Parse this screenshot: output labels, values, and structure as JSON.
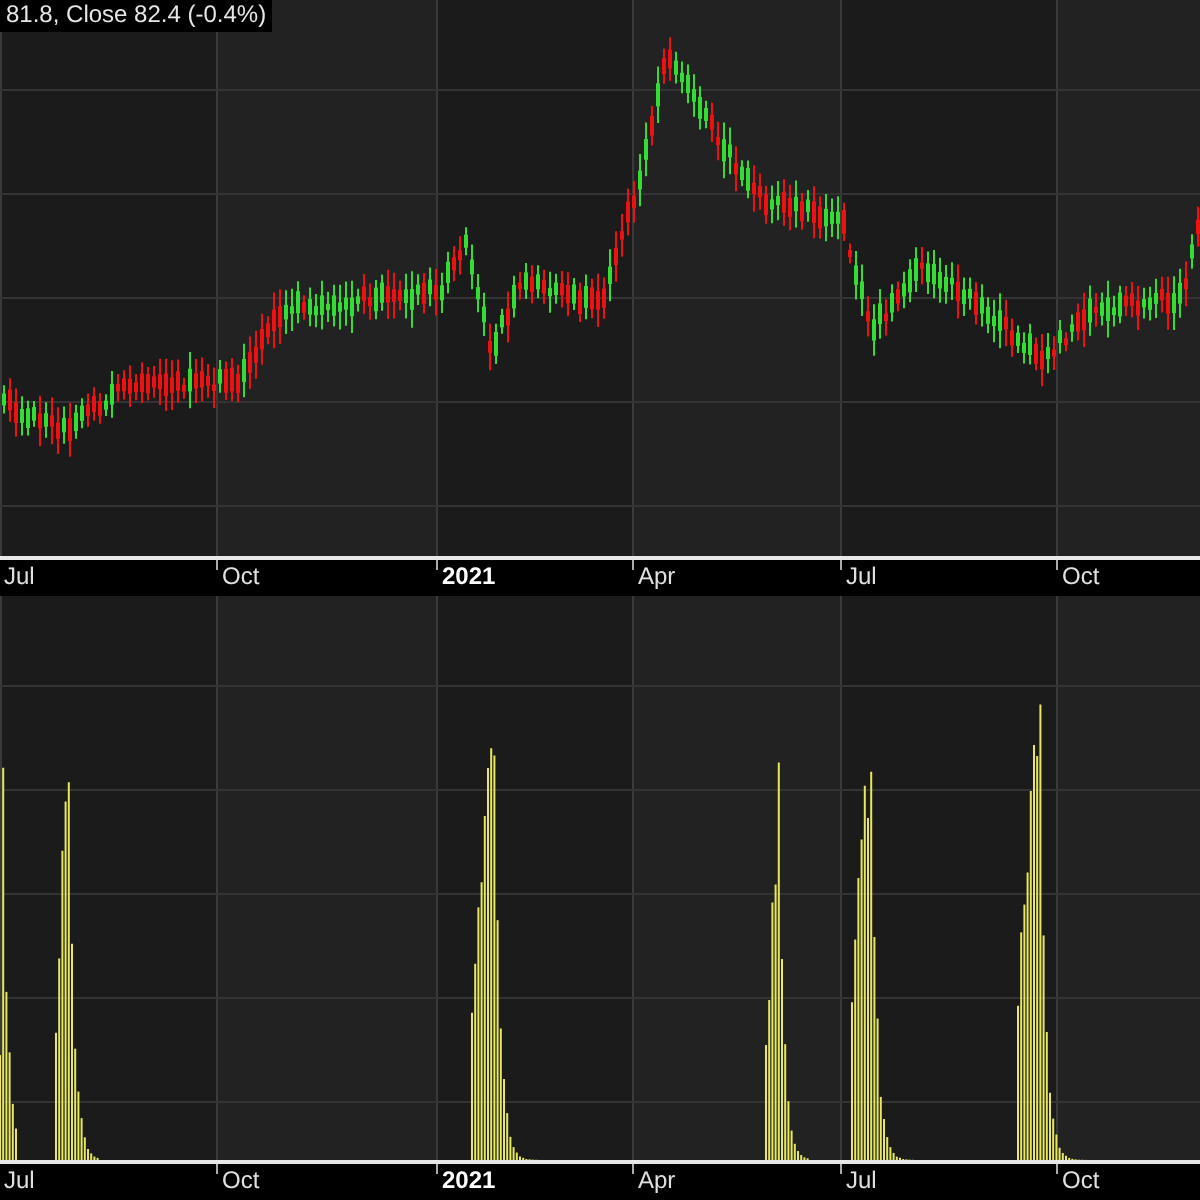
{
  "legend": "81.8, Close 82.4 (-0.4%)",
  "price_panel": {
    "axis_labels": [
      {
        "text": "Jul",
        "kind": "month"
      },
      {
        "text": "Oct",
        "kind": "month"
      },
      {
        "text": "2021",
        "kind": "year"
      },
      {
        "text": "Apr",
        "kind": "month"
      },
      {
        "text": "Jul",
        "kind": "month"
      },
      {
        "text": "Oct",
        "kind": "month"
      }
    ]
  },
  "indicator_panel": {
    "axis_labels": [
      {
        "text": "Jul",
        "kind": "month"
      },
      {
        "text": "Oct",
        "kind": "month"
      },
      {
        "text": "2021",
        "kind": "year"
      },
      {
        "text": "Apr",
        "kind": "month"
      },
      {
        "text": "Jul",
        "kind": "month"
      },
      {
        "text": "Oct",
        "kind": "month"
      }
    ]
  }
}
